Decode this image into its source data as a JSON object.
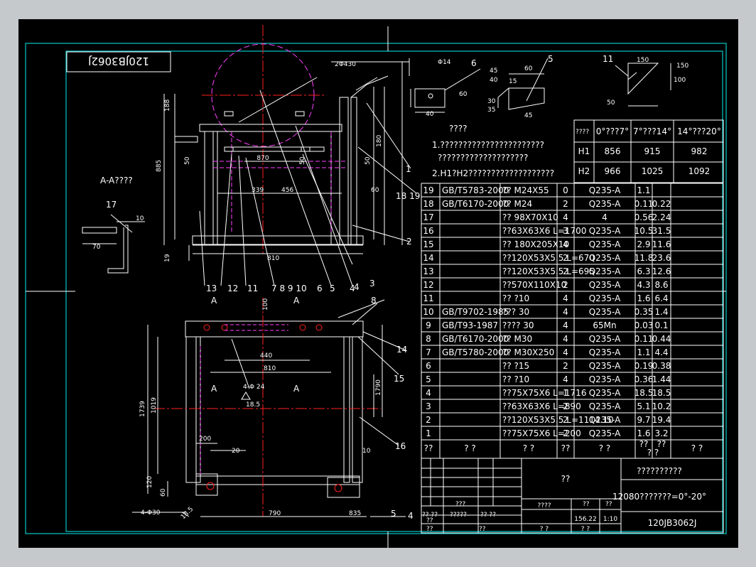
{
  "title_block_stamp": "120JB3062J",
  "view_caption": "A-A????",
  "notes": {
    "heading": "????",
    "note1_line1": "1.???????????????????????",
    "note1_line2": "????????????????????",
    "note2": "2.H1?H2???????????????????"
  },
  "height_table": {
    "headers": [
      "????",
      "0°???7°",
      "7°???14°",
      "14°???20°"
    ],
    "rows": [
      {
        "label": "H1",
        "values": [
          "856",
          "915",
          "982"
        ]
      },
      {
        "label": "H2",
        "values": [
          "966",
          "1025",
          "1092"
        ]
      }
    ]
  },
  "bom": {
    "rows": [
      {
        "no": "19",
        "std": "GB/T5783-2000",
        "name": "?? M24X55",
        "qty": "0",
        "mat": "Q235-A",
        "w1": "1.1",
        "w2": ""
      },
      {
        "no": "18",
        "std": "GB/T6170-2000",
        "name": "?? M24",
        "qty": "2",
        "mat": "Q235-A",
        "w1": "0.11",
        "w2": "0.22"
      },
      {
        "no": "17",
        "std": "",
        "name": "?? 98X70X10",
        "qty": "4",
        "mat": "4",
        "w1": "0.56",
        "w2": "2.24"
      },
      {
        "no": "16",
        "std": "",
        "name": "??63X63X6 L=1700",
        "qty": "3",
        "mat": "Q235-A",
        "w1": "10.5",
        "w2": "31.5"
      },
      {
        "no": "15",
        "std": "",
        "name": "?? 180X205X10",
        "qty": "4",
        "mat": "Q235-A",
        "w1": "2.9",
        "w2": "11.6"
      },
      {
        "no": "14",
        "std": "",
        "name": "??120X53X5.5  L=670",
        "qty": "2",
        "mat": "Q235-A",
        "w1": "11.8",
        "w2": "23.6"
      },
      {
        "no": "13",
        "std": "",
        "name": "??120X53X5.5  L=695",
        "qty": "2",
        "mat": "Q235-A",
        "w1": "6.3",
        "w2": "12.6"
      },
      {
        "no": "12",
        "std": "",
        "name": "??570X110X10",
        "qty": "2",
        "mat": "Q235-A",
        "w1": "4.3",
        "w2": "8.6"
      },
      {
        "no": "11",
        "std": "",
        "name": "?? ?10",
        "qty": "4",
        "mat": "Q235-A",
        "w1": "1.6",
        "w2": "6.4"
      },
      {
        "no": "10",
        "std": "GB/T9702-1985",
        "name": "???  30",
        "qty": "4",
        "mat": "Q235-A",
        "w1": "0.35",
        "w2": "1.4"
      },
      {
        "no": "9",
        "std": "GB/T93-1987",
        "name": "???? 30",
        "qty": "4",
        "mat": "65Mn",
        "w1": "0.03",
        "w2": "0.1"
      },
      {
        "no": "8",
        "std": "GB/T6170-2000",
        "name": "?? M30",
        "qty": "4",
        "mat": "Q235-A",
        "w1": "0.11",
        "w2": "0.44"
      },
      {
        "no": "7",
        "std": "GB/T5780-2000",
        "name": "?? M30X250",
        "qty": "4",
        "mat": "Q235-A",
        "w1": "1.1",
        "w2": "4.4"
      },
      {
        "no": "6",
        "std": "",
        "name": "??  ?15",
        "qty": "2",
        "mat": "Q235-A",
        "w1": "0.19",
        "w2": "0.38"
      },
      {
        "no": "5",
        "std": "",
        "name": "??  ?10",
        "qty": "4",
        "mat": "Q235-A",
        "w1": "0.36",
        "w2": "1.44"
      },
      {
        "no": "4",
        "std": "",
        "name": "??75X75X6 L=1716",
        "qty": "1",
        "mat": "Q235-A",
        "w1": "18.5",
        "w2": "18.5"
      },
      {
        "no": "3",
        "std": "",
        "name": "??63X63X6 L=890",
        "qty": "2",
        "mat": "Q235-A",
        "w1": "5.1",
        "w2": "10.2"
      },
      {
        "no": "2",
        "std": "",
        "name": "??120X53X5.5  L=1114.10",
        "qty": "2",
        "mat": "Q235-A",
        "w1": "9.7",
        "w2": "19.4"
      },
      {
        "no": "1",
        "std": "",
        "name": "??75X75X6 L=200",
        "qty": "2",
        "mat": "Q235-A",
        "w1": "1.6",
        "w2": "3.2"
      }
    ],
    "header": {
      "no": "??",
      "std": "? ?",
      "name": "? ?",
      "qty": "??",
      "mat": "? ?",
      "w_a": "??",
      "w_b": "??",
      "w_c": "? ?",
      "note": "? ?"
    }
  },
  "title_block": {
    "part_name": "??",
    "project_name": "??????????",
    "description": "12080???????=0°-20°",
    "drawing_number": "120JB3062J",
    "scale_header": "????",
    "weight": "156.22",
    "scale": "1:10",
    "sheet_a": "? ?",
    "sheet_b": "? ?",
    "cells": {
      "a": "?? ??",
      "b": "?????",
      "c": "?? ??",
      "d": "???",
      "e": "??",
      "f": "??",
      "g": "??",
      "h": "??",
      "i": "??"
    }
  },
  "section_marks": {
    "a_left": "A",
    "a_right": "A",
    "a_left2": "A",
    "a_right2": "A"
  },
  "callouts": [
    "1",
    "2",
    "3",
    "4",
    "5",
    "6",
    "7 8 9 10",
    "11",
    "12",
    "13",
    "14",
    "15",
    "16",
    "17",
    "18 19",
    "6",
    "5",
    "11",
    "4",
    "4",
    "5",
    "8"
  ],
  "dimensions": {
    "top_view": [
      "870",
      "50",
      "50",
      "339",
      "456",
      "60",
      "810",
      "188",
      "885",
      "50",
      "19",
      "180"
    ],
    "bottom_view": [
      "100",
      "440",
      "810",
      "1739",
      "1019",
      "120",
      "200",
      "20",
      "790",
      "1790",
      "10",
      "835",
      "60",
      "4-Φ30",
      "4-Φ 24",
      "18.5",
      "18.5"
    ],
    "section": [
      "10",
      "70"
    ],
    "details": [
      "2Φ430",
      "Φ14",
      "40",
      "60",
      "15",
      "60",
      "45",
      "40",
      "45",
      "30",
      "35",
      "150",
      "100",
      "50",
      "150"
    ]
  },
  "colors": {
    "background": "#000000",
    "frame": "#00c8c8",
    "lines": "#ffffff",
    "centerline": "#ff2020",
    "hidden": "#ff40ff",
    "dims": "#ffffff"
  }
}
